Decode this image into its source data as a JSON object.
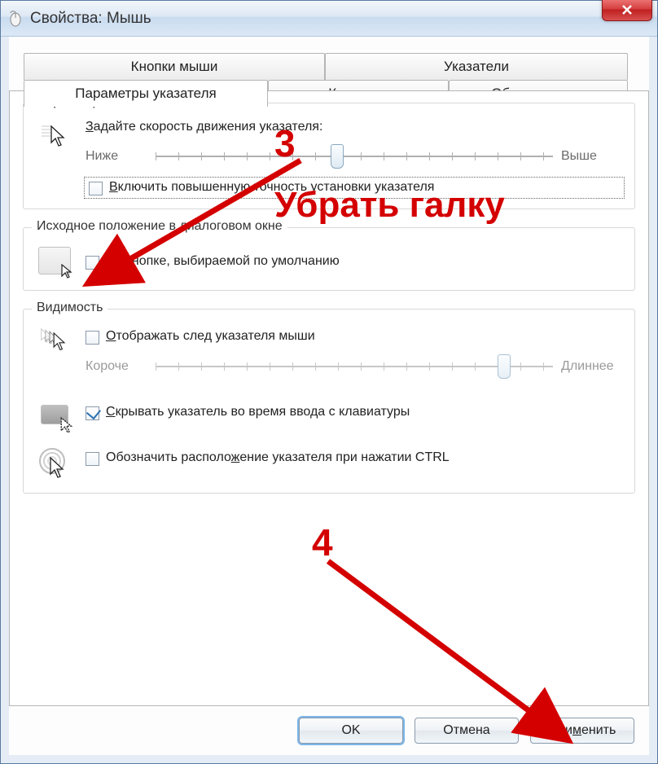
{
  "window": {
    "title": "Свойства: Мышь"
  },
  "tabs": {
    "buttons": "Кнопки мыши",
    "pointers": "Указатели",
    "pointer_options": "Параметры указателя",
    "wheel": "Колесико",
    "hardware": "Оборудование"
  },
  "motion": {
    "group_title": "Перемещение",
    "speed_label": "Задайте скорость движения указателя:",
    "slow": "Ниже",
    "fast": "Выше",
    "slider_value": 5,
    "enhance_precision_label": "Включить повышенную точность установки указателя",
    "enhance_precision_checked": false
  },
  "snap": {
    "group_title": "Исходное положение в диалоговом окне",
    "label": "На кнопке, выбираемой по умолчанию",
    "checked": false
  },
  "visibility": {
    "group_title": "Видимость",
    "trails_label": "Отображать след указателя мыши",
    "trails_checked": false,
    "trails_short": "Короче",
    "trails_long": "Длиннее",
    "trails_value": 9,
    "hide_typing_label": "Скрывать указатель во время ввода с клавиатуры",
    "hide_typing_checked": true,
    "ctrl_locate_label": "Обозначить расположение указателя при нажатии CTRL",
    "ctrl_locate_checked": false
  },
  "buttons": {
    "ok": "OK",
    "cancel": "Отмена",
    "apply": "Применить"
  },
  "annotations": {
    "num3": "3",
    "text": "Убрать галку",
    "num4": "4"
  }
}
